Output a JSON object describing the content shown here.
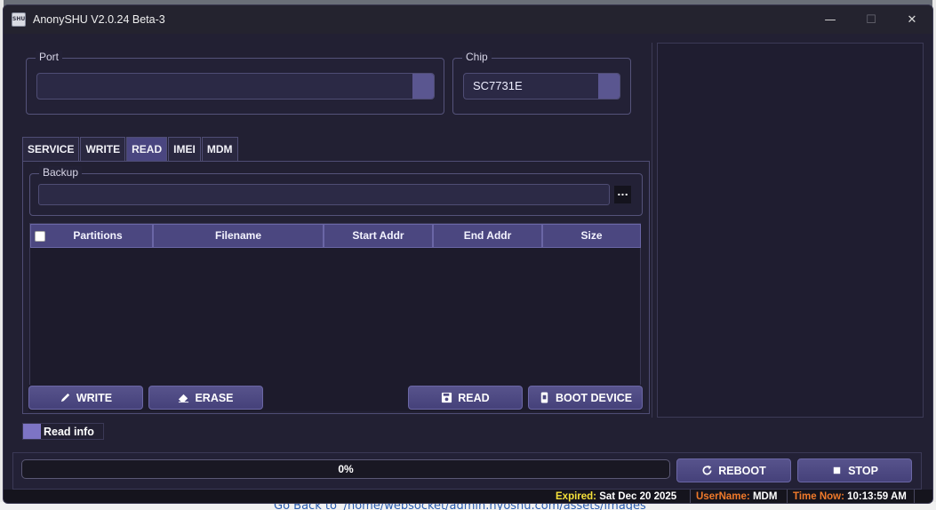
{
  "window": {
    "title": "AnonySHU V2.0.24 Beta-3",
    "icon_text": "SHU",
    "controls": {
      "minimize": "—",
      "maximize": "☐",
      "close": "✕"
    }
  },
  "port": {
    "label": "Port",
    "value": ""
  },
  "chip": {
    "label": "Chip",
    "value": "SC7731E"
  },
  "tabs": [
    {
      "label": "SERVICE",
      "active": false
    },
    {
      "label": "WRITE",
      "active": false
    },
    {
      "label": "READ",
      "active": true
    },
    {
      "label": "IMEI",
      "active": false
    },
    {
      "label": "MDM",
      "active": false
    }
  ],
  "backup": {
    "label": "Backup",
    "path": "",
    "browse_label": "..."
  },
  "table": {
    "columns": [
      "Partitions",
      "Filename",
      "Start Addr",
      "End Addr",
      "Size"
    ],
    "rows": []
  },
  "actions": {
    "write": "WRITE",
    "erase": "ERASE",
    "read": "READ",
    "boot_device": "BOOT DEVICE"
  },
  "read_info": {
    "label": "Read info",
    "color": "#7d74c4"
  },
  "progress": {
    "text": "0%",
    "value": 0
  },
  "controls": {
    "reboot": "REBOOT",
    "stop": "STOP"
  },
  "status": {
    "expired_label": "Expired:",
    "expired_value": "Sat Dec 20 2025",
    "username_label": "UserName:",
    "username_value": "MDM",
    "time_label": "Time Now:",
    "time_value": "10:13:59 AM",
    "colors": {
      "expired": "#f5e13a",
      "username": "#f07a2a",
      "time": "#f07a2a"
    }
  },
  "background_text": "Go Back to '/home/websocket/admin.hyoshu.com/assets/images'"
}
